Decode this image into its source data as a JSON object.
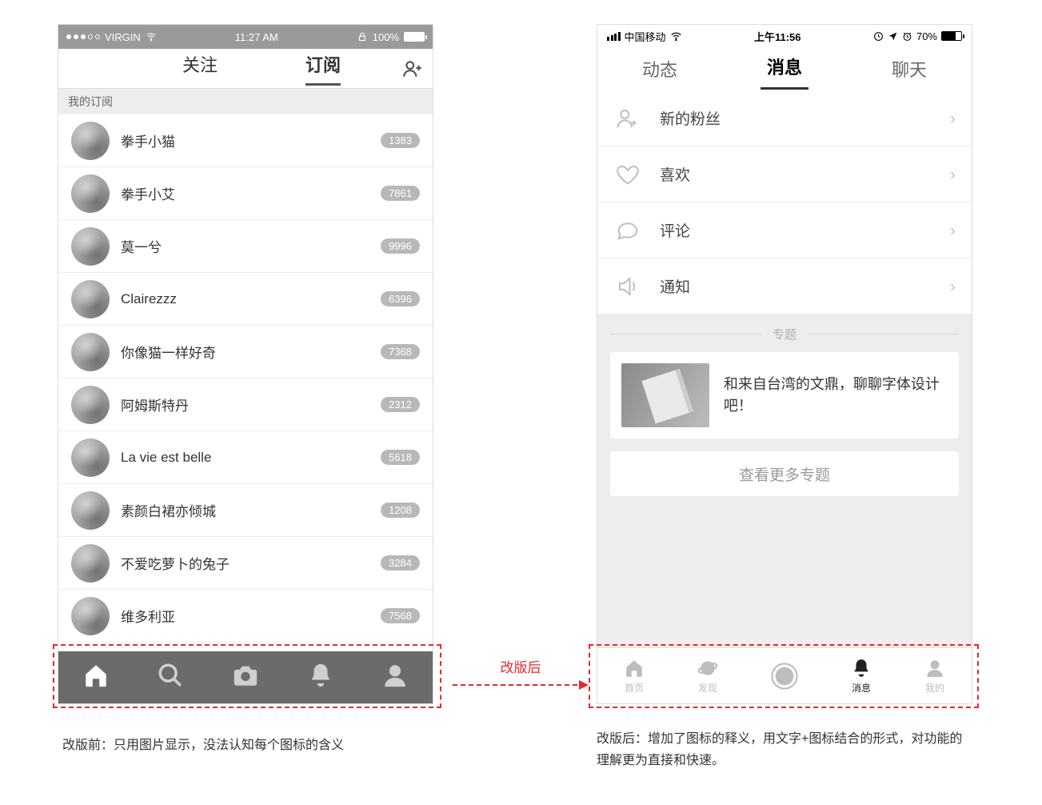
{
  "left_phone": {
    "status": {
      "carrier": "VIRGIN",
      "time": "11:27 AM",
      "battery_pct": "100%"
    },
    "tabs": {
      "follow": "关注",
      "subscribe": "订阅"
    },
    "section_title": "我的订阅",
    "subs": [
      {
        "name": "拳手小猫",
        "count": "1383"
      },
      {
        "name": "拳手小艾",
        "count": "7861"
      },
      {
        "name": "莫一兮",
        "count": "9996"
      },
      {
        "name": "Clairezzz",
        "count": "6396"
      },
      {
        "name": "你像猫一样好奇",
        "count": "7368"
      },
      {
        "name": "阿姆斯特丹",
        "count": "2312"
      },
      {
        "name": "La vie est belle",
        "count": "5618"
      },
      {
        "name": "素颜白裙亦倾城",
        "count": "1208"
      },
      {
        "name": "不爱吃萝卜的兔子",
        "count": "3284"
      },
      {
        "name": "维多利亚",
        "count": "7568"
      }
    ]
  },
  "right_phone": {
    "status": {
      "carrier": "中国移动",
      "time": "上午11:56",
      "battery_pct": "70%"
    },
    "tabs": {
      "feed": "动态",
      "messages": "消息",
      "chat": "聊天"
    },
    "menu": {
      "new_followers": "新的粉丝",
      "likes": "喜欢",
      "comments": "评论",
      "notifications": "通知"
    },
    "topic": {
      "divider": "专题",
      "card_text": "和来自台湾的文鼎，聊聊字体设计吧！",
      "more": "查看更多专题"
    },
    "bottom_nav": {
      "home": "首页",
      "discover": "发现",
      "messages": "消息",
      "me": "我的"
    }
  },
  "arrow_label": "改版后",
  "caption_left": "改版前：只用图片显示，没法认知每个图标的含义",
  "caption_right": "改版后：增加了图标的释义，用文字+图标结合的形式，对功能的理解更为直接和快速。"
}
